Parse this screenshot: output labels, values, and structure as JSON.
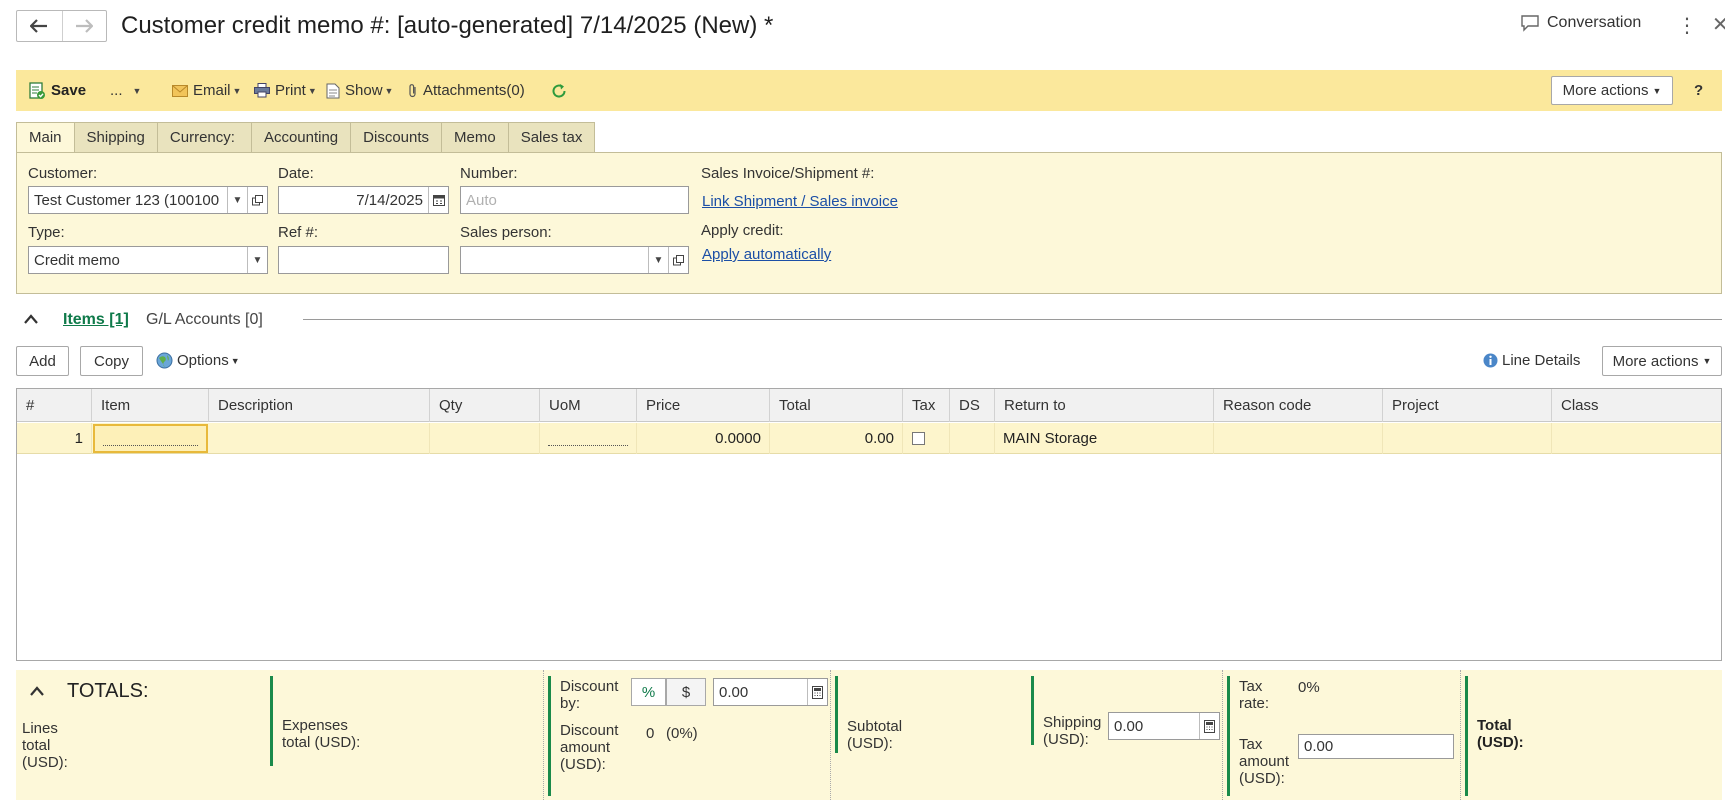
{
  "window": {
    "title": "Customer credit memo #: [auto-generated] 7/14/2025 (New) *",
    "conversation_label": "Conversation"
  },
  "toolbar": {
    "save_label": "Save",
    "ellipsis_label": "...",
    "email_label": "Email",
    "print_label": "Print",
    "show_label": "Show",
    "attachments_label": "Attachments(0)",
    "more_actions_label": "More actions",
    "help_label": "?"
  },
  "tabs": [
    "Main",
    "Shipping",
    "Currency:",
    "Accounting",
    "Discounts",
    "Memo",
    "Sales tax"
  ],
  "form": {
    "customer_label": "Customer:",
    "customer_value": "Test Customer 123 (100100",
    "date_label": "Date:",
    "date_value": "7/14/2025",
    "number_label": "Number:",
    "number_placeholder": "Auto",
    "sales_invoice_label": "Sales Invoice/Shipment #:",
    "link_shipment": "Link Shipment / Sales invoice",
    "type_label": "Type:",
    "type_value": "Credit memo",
    "ref_label": "Ref #:",
    "ref_value": "",
    "sales_person_label": "Sales person:",
    "sales_person_value": "",
    "apply_credit_label": "Apply credit:",
    "apply_automatically": "Apply automatically"
  },
  "section": {
    "items_tab": "Items [1]",
    "gl_tab": "G/L Accounts [0]"
  },
  "grid_toolbar": {
    "add_label": "Add",
    "copy_label": "Copy",
    "options_label": "Options",
    "line_details_label": "Line Details",
    "more_actions_label": "More actions"
  },
  "grid": {
    "columns": [
      "#",
      "Item",
      "Description",
      "Qty",
      "UoM",
      "Price",
      "Total",
      "Tax",
      "DS",
      "Return to",
      "Reason code",
      "Project",
      "Class"
    ],
    "rows": [
      {
        "num": "1",
        "item": "",
        "description": "",
        "qty": "",
        "uom": "",
        "price": "0.0000",
        "total": "0.00",
        "tax": false,
        "ds": "",
        "return_to": "MAIN Storage",
        "reason_code": "",
        "project": "",
        "class": ""
      }
    ]
  },
  "totals": {
    "title": "TOTALS:",
    "lines_total_label": "Lines total (USD):",
    "expenses_total_label": "Expenses total (USD):",
    "discount_by_label": "Discount by:",
    "discount_pct": "%",
    "discount_dollar": "$",
    "discount_value": "0.00",
    "discount_amount_label": "Discount amount (USD):",
    "discount_amount_value": "0",
    "discount_amount_pct": "(0%)",
    "subtotal_label": "Subtotal (USD):",
    "shipping_label": "Shipping (USD):",
    "shipping_value": "0.00",
    "tax_rate_label": "Tax rate:",
    "tax_rate_value": "0%",
    "tax_amount_label": "Tax amount (USD):",
    "tax_amount_value": "0.00",
    "total_label": "Total (USD):"
  },
  "colors": {
    "toolbar_bg": "#fbe89c",
    "panel_bg": "#fdf8d9",
    "accent_green": "#0f7a4a",
    "link_blue": "#1c4fa6"
  }
}
